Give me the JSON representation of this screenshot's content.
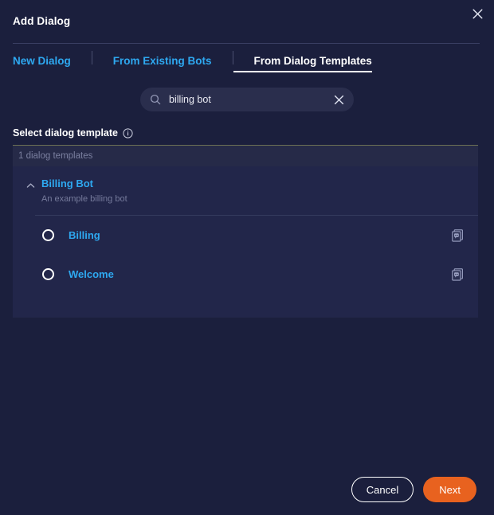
{
  "window": {
    "title": "Add Dialog",
    "close_icon": "close-icon"
  },
  "tabs": [
    {
      "label": "New Dialog",
      "active": false
    },
    {
      "label": "From Existing Bots",
      "active": false
    },
    {
      "label": "From Dialog Templates",
      "active": true
    }
  ],
  "search": {
    "icon": "search-icon",
    "value": "billing bot",
    "placeholder": "Search",
    "clear_icon": "close-icon"
  },
  "select_section": {
    "label": "Select dialog template",
    "info_icon": "info-icon"
  },
  "list": {
    "count_label": "1 dialog templates",
    "groups": [
      {
        "title": "Billing Bot",
        "description": "An example billing bot",
        "expanded": true,
        "chevron_icon": "chevron-up-icon",
        "templates": [
          {
            "name": "Billing",
            "selected": false,
            "action_icon": "duplicate-icon"
          },
          {
            "name": "Welcome",
            "selected": false,
            "action_icon": "duplicate-icon"
          }
        ]
      }
    ]
  },
  "footer": {
    "cancel_label": "Cancel",
    "next_label": "Next"
  },
  "colors": {
    "background": "#1b1f3d",
    "panel": "#22264a",
    "panel_header": "#262a48",
    "accent_link": "#2ea8f0",
    "primary_button": "#e8621f",
    "muted_text": "#767b9c"
  }
}
